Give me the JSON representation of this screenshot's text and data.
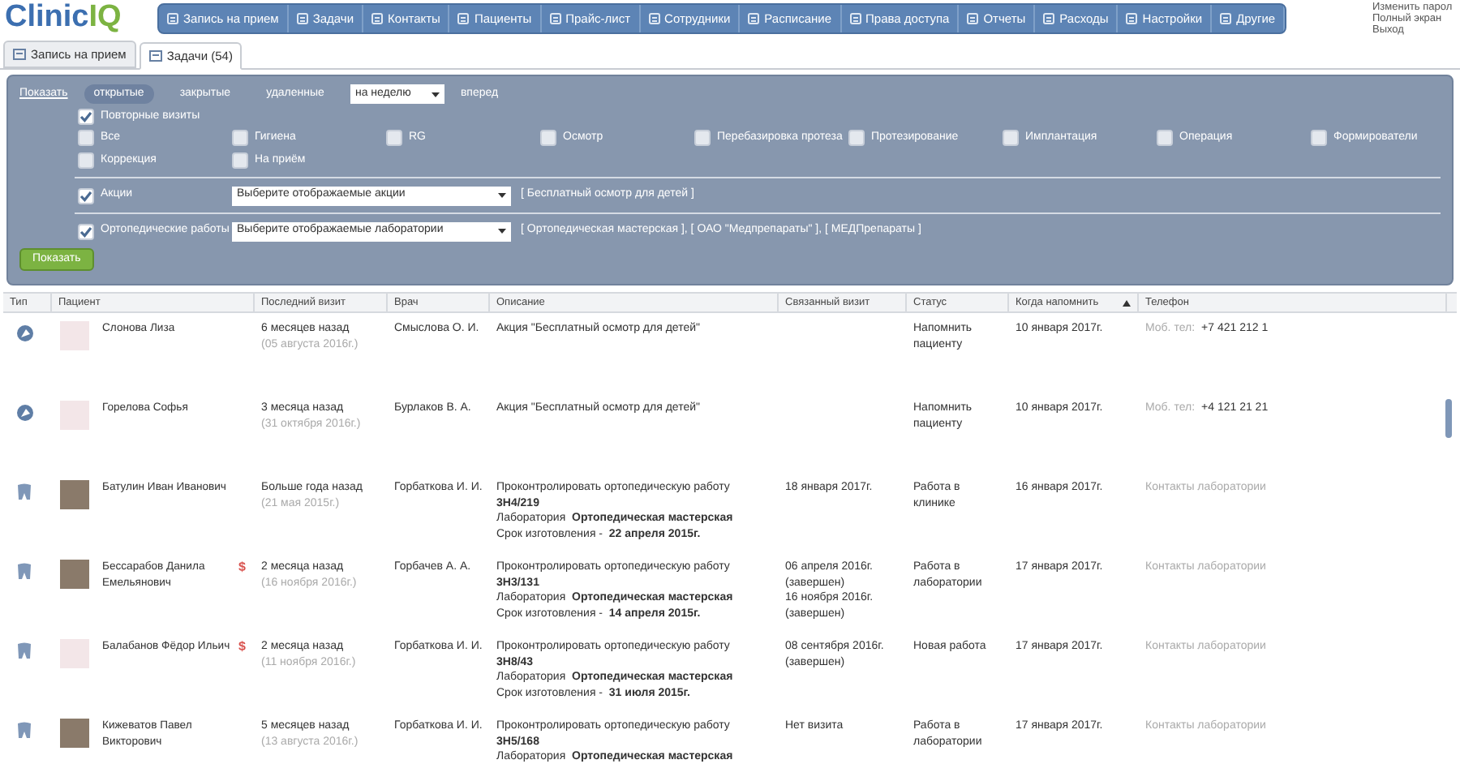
{
  "logo": {
    "text_a": "Clinic",
    "text_b": "IQ"
  },
  "nav": [
    {
      "label": "Запись на прием"
    },
    {
      "label": "Задачи"
    },
    {
      "label": "Контакты"
    },
    {
      "label": "Пациенты"
    },
    {
      "label": "Прайс-лист"
    },
    {
      "label": "Сотрудники"
    },
    {
      "label": "Расписание"
    },
    {
      "label": "Права доступа"
    },
    {
      "label": "Отчеты"
    },
    {
      "label": "Расходы"
    },
    {
      "label": "Настройки"
    },
    {
      "label": "Другие"
    }
  ],
  "user_links": [
    "Изменить парол",
    "Полный экран",
    "Выход"
  ],
  "tabs": [
    {
      "label": "Запись на прием",
      "selected": false
    },
    {
      "label": "Задачи (54)",
      "selected": true
    }
  ],
  "filter": {
    "show_link": "Показать",
    "states": [
      {
        "label": "открытые",
        "selected": true
      },
      {
        "label": "закрытые",
        "selected": false
      },
      {
        "label": "удаленные",
        "selected": false
      }
    ],
    "period": "на неделю",
    "direction": "вперед",
    "repeat": {
      "label": "Повторные визиты",
      "checked": true
    },
    "categories": [
      {
        "label": "Все",
        "checked": false
      },
      {
        "label": "Гигиена",
        "checked": false
      },
      {
        "label": "RG",
        "checked": false
      },
      {
        "label": "Осмотр",
        "checked": false
      },
      {
        "label": "Перебазировка протеза",
        "checked": false
      },
      {
        "label": "Протезирование",
        "checked": false
      },
      {
        "label": "Имплантация",
        "checked": false
      },
      {
        "label": "Операция",
        "checked": false
      },
      {
        "label": "Формирователи",
        "checked": false
      },
      {
        "label": "Коррекция",
        "checked": false
      },
      {
        "label": "На приём",
        "checked": false
      }
    ],
    "groups": [
      {
        "label": "Акции",
        "checked": true,
        "select": "Выберите отображаемые акции",
        "chosen": "[ Бесплатный осмотр для детей ]"
      },
      {
        "label": "Ортопедические работы",
        "checked": true,
        "select": "Выберите отображаемые лаборатории",
        "chosen": "[ Ортопедическая мастерская ], [ ОАО \"Медпрепараты\" ], [ МЕДПрепараты ]"
      }
    ],
    "submit": "Показать"
  },
  "table": {
    "columns": [
      {
        "label": "Тип",
        "sorted": false
      },
      {
        "label": "Пациент",
        "sorted": false
      },
      {
        "label": "Последний визит",
        "sorted": false
      },
      {
        "label": "Врач",
        "sorted": false
      },
      {
        "label": "Описание",
        "sorted": false
      },
      {
        "label": "Связанный визит",
        "sorted": false
      },
      {
        "label": "Статус",
        "sorted": false
      },
      {
        "label": "Когда напомнить",
        "sorted": true
      },
      {
        "label": "Телефон",
        "sorted": false
      }
    ],
    "rows": [
      {
        "kind": "promo",
        "photo": false,
        "patient": "Слонова Лиза",
        "last_visit": "6 месяцев назад",
        "last_visit_date": "(05 августа 2016г.)",
        "doctor": "Смыслова О. И.",
        "description": [
          "Акция \"Бесплатный осмотр для детей\""
        ],
        "linked": [],
        "status": "Напомнить пациенту",
        "remind": "10 января 2017г.",
        "phone_label": "Моб. тел:",
        "phone": "+7 421 212 1"
      },
      {
        "kind": "promo",
        "photo": false,
        "patient": "Горелова Софья",
        "last_visit": "3 месяца назад",
        "last_visit_date": "(31 октября 2016г.)",
        "doctor": "Бурлаков В. А.",
        "description": [
          "Акция \"Бесплатный осмотр для детей\""
        ],
        "linked": [],
        "status": "Напомнить пациенту",
        "remind": "10 января 2017г.",
        "phone_label": "Моб. тел:",
        "phone": "+4 121 21 21"
      },
      {
        "kind": "ortho",
        "photo": true,
        "patient": "Батулин Иван Иванович",
        "last_visit": "Больше года назад",
        "last_visit_date": "(21 мая 2015г.)",
        "doctor": "Горбаткова И. И.",
        "description": [
          "Проконтролировать ортопедическую работу",
          "**3Н4/219**",
          "Лаборатория  **Ортопедическая мастерская**",
          "Срок изготовления -  **22 апреля 2015г.**"
        ],
        "linked": [
          "18 января 2017г."
        ],
        "status": "Работа в клинике",
        "remind": "16 января 2017г.",
        "phone_label": "Контакты лаборатории"
      },
      {
        "kind": "ortho",
        "photo": true,
        "patient": "Бессарабов Данила Емельянович",
        "debt_mark": "$",
        "last_visit": "2 месяца назад",
        "last_visit_date": "(16 ноября 2016г.)",
        "doctor": "Горбачев А. А.",
        "description": [
          "Проконтролировать ортопедическую работу",
          "**3Н3/131**",
          "Лаборатория  **Ортопедическая мастерская**",
          "Срок изготовления -  **14 апреля 2015г.**"
        ],
        "linked": [
          "06 апреля 2016г. (завершен)",
          "16 ноября 2016г. (завершен)"
        ],
        "status": "Работа в лаборатории",
        "remind": "17 января 2017г.",
        "phone_label": "Контакты лаборатории"
      },
      {
        "kind": "ortho",
        "photo": false,
        "patient": "Балабанов Фёдор Ильич",
        "debt_mark": "$",
        "last_visit": "2 месяца назад",
        "last_visit_date": "(11 ноября 2016г.)",
        "doctor": "Горбаткова И. И.",
        "description": [
          "Проконтролировать ортопедическую работу",
          "**3Н8/43**",
          "Лаборатория  **Ортопедическая мастерская**",
          "Срок изготовления -  **31 июля 2015г.**"
        ],
        "linked": [
          "08 сентября 2016г. (завершен)"
        ],
        "status": "Новая работа",
        "remind": "17 января 2017г.",
        "phone_label": "Контакты лаборатории"
      },
      {
        "kind": "ortho",
        "photo": true,
        "patient": "Кижеватов Павел Викторович",
        "last_visit": "5 месяцев назад",
        "last_visit_date": "(13 августа 2016г.)",
        "doctor": "Горбаткова И. И.",
        "description": [
          "Проконтролировать ортопедическую работу",
          "**3Н5/168**",
          "Лаборатория  **Ортопедическая мастерская**"
        ],
        "linked": [
          "Нет визита"
        ],
        "status": "Работа в лаборатории",
        "remind": "17 января 2017г.",
        "phone_label": "Контакты лаборатории"
      }
    ]
  }
}
